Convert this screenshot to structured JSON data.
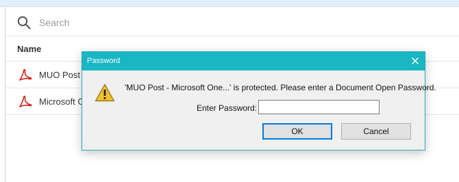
{
  "search": {
    "placeholder": "Search",
    "icon": "search-icon"
  },
  "file_list": {
    "column_header": "Name",
    "rows": [
      {
        "name": "MUO Post",
        "icon": "pdf-icon"
      },
      {
        "name": "Microsoft C",
        "icon": "pdf-icon"
      }
    ]
  },
  "dialog": {
    "title": "Password",
    "message": "'MUO Post - Microsoft One...' is protected. Please enter a Document Open Password.",
    "password_label": "Enter Password:",
    "password_value": "",
    "ok_label": "OK",
    "cancel_label": "Cancel",
    "warning_icon": "warning-icon",
    "close_icon": "close-icon"
  },
  "colors": {
    "titlebar": "#19b6c4",
    "top_strip": "#e2eff9",
    "pdf_red": "#d42a20",
    "warning_yellow": "#f2c12e",
    "ok_border": "#0078d7"
  }
}
